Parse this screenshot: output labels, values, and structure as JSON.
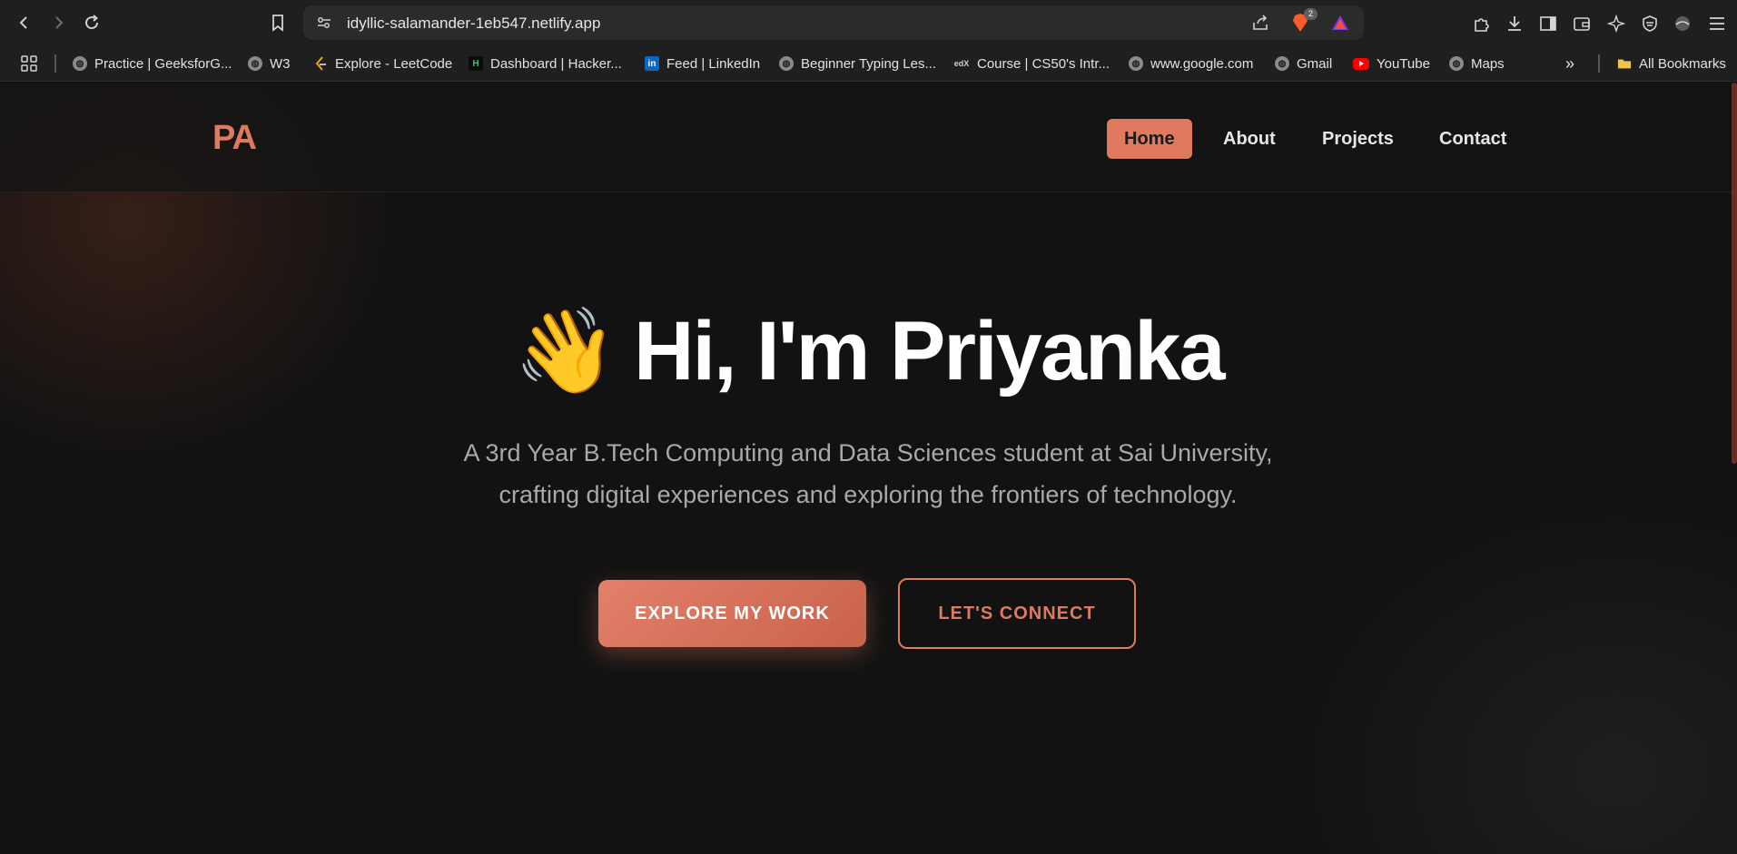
{
  "browser": {
    "url": "idyllic-salamander-1eb547.netlify.app",
    "brave_badge": "2",
    "bookmarks": [
      {
        "label": "Practice | GeeksforG..."
      },
      {
        "label": "W3"
      },
      {
        "label": "Explore - LeetCode"
      },
      {
        "label": "Dashboard | Hacker..."
      },
      {
        "label": "Feed | LinkedIn"
      },
      {
        "label": "Beginner Typing Les..."
      },
      {
        "label": "Course | CS50's Intr..."
      },
      {
        "label": "www.google.com"
      },
      {
        "label": "Gmail"
      },
      {
        "label": "YouTube"
      },
      {
        "label": "Maps"
      }
    ],
    "all_bookmarks": "All Bookmarks",
    "more_chevron": "»",
    "hackerrank_fav": "H",
    "edx_fav": "edX",
    "linkedin_fav": "in"
  },
  "site": {
    "logo": "PA",
    "nav": [
      {
        "label": "Home",
        "active": true
      },
      {
        "label": "About"
      },
      {
        "label": "Projects"
      },
      {
        "label": "Contact"
      }
    ],
    "hero": {
      "emoji": "👋",
      "title": "Hi, I'm Priyanka",
      "subtitle_line1": "A 3rd Year B.Tech Computing and Data Sciences student at Sai University,",
      "subtitle_line2": "crafting digital experiences and exploring the frontiers of technology."
    },
    "buttons": {
      "primary": "EXPLORE MY WORK",
      "secondary": "LET'S CONNECT"
    }
  },
  "colors": {
    "accent": "#e07a5f",
    "background": "#121212",
    "chrome": "#1f1f1f"
  }
}
